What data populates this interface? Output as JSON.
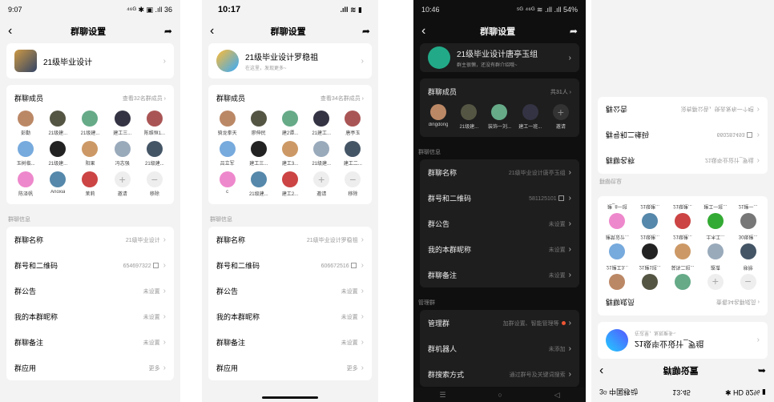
{
  "p1": {
    "time": "9:07",
    "status": "⁴⁶ᴳ ✱ ▣ .ıll 36",
    "title": "群聊设置",
    "group": "21级毕业设计",
    "members_label": "群聊成员",
    "members_more": "查看32名群成员",
    "members": [
      "彭勤",
      "21级建...",
      "21级建...",
      "建工三...",
      "陈维恒1...",
      "玉树临...",
      "21级建...",
      "阳果",
      "冯志强",
      "21级建...",
      "陈泽帆",
      "Anoxia",
      "茉莉",
      "邀请",
      "移除"
    ],
    "section": "群聊信息",
    "rows": [
      {
        "k": "群聊名称",
        "v": "21级毕业设计"
      },
      {
        "k": "群号和二维码",
        "v": "654697322"
      },
      {
        "k": "群公告",
        "v": "未设置"
      },
      {
        "k": "我的本群昵称",
        "v": "未设置"
      },
      {
        "k": "群聊备注",
        "v": "未设置"
      },
      {
        "k": "群应用",
        "v": "更多"
      }
    ]
  },
  "p2": {
    "time": "10:17",
    "title": "群聊设置",
    "group": "21级毕业设计罗稳祖",
    "group_sub": "在这里，发现更多~",
    "members_label": "群聊成员",
    "members_more": "查看34名群成员",
    "members": [
      "骑龙拳天",
      "廖伸民",
      "建2谭...",
      "21建工...",
      "唐亭玉",
      "吕立军",
      "建工三...",
      "建工3...",
      "21级建...",
      "建工二...",
      "c",
      "21级建...",
      "建工2...",
      "邀请",
      "移除"
    ],
    "section": "群聊信息",
    "rows": [
      {
        "k": "群聊名称",
        "v": "21级毕业设计罗稳祖"
      },
      {
        "k": "群号和二维码",
        "v": "606672516"
      },
      {
        "k": "群公告",
        "v": "未设置"
      },
      {
        "k": "我的本群昵称",
        "v": "未设置"
      },
      {
        "k": "群聊备注",
        "v": "未设置"
      },
      {
        "k": "群应用",
        "v": "更多"
      }
    ]
  },
  "p3": {
    "time": "10:46",
    "status": "⁵ᴳ ⁴⁶ᴳ ≋ .ıll .ıll 54%",
    "title": "群聊设置",
    "group": "21级毕业设计唐亭玉组",
    "group_sub": "群主很懒，还没有群介绍哦~",
    "members_label": "群聊成员",
    "members_more": "共31人",
    "members": [
      "dingdong",
      "21级建...",
      "装饰一刘...",
      "建工一班...",
      "邀请"
    ],
    "section": "群聊信息",
    "rows": [
      {
        "k": "群聊名称",
        "v": "21级毕业设计唐亭玉组"
      },
      {
        "k": "群号和二维码",
        "v": "581125101"
      },
      {
        "k": "群公告",
        "v": "未设置"
      },
      {
        "k": "我的本群昵称",
        "v": "未设置"
      },
      {
        "k": "群聊备注",
        "v": "未设置"
      }
    ],
    "section2": "管理群",
    "rows2": [
      {
        "k": "管理群",
        "v": "加群设置、智能管理等"
      },
      {
        "k": "群机器人",
        "v": "未添加"
      },
      {
        "k": "群搜索方式",
        "v": "通过群号及关键词搜索"
      }
    ]
  },
  "p4": {
    "time": "13:45",
    "carrier": "3ᴳ 中国移动",
    "title": "群聊设置",
    "group": "21级毕业设计_罗组",
    "group_sub": "在这里，发现更多~",
    "members_label": "群聊成员",
    "members_more": "查看34名群成员",
    "members": [
      "21建工3...",
      "21建1班...",
      "装饰二班...",
      "邀请",
      "移除",
      "建筑设计...",
      "21级建...",
      "21级建...",
      "土木工...",
      "30级建...",
      "建_8一班",
      "21级建...",
      "21级建...",
      "建工一班...",
      "21建一..."
    ],
    "section": "群聊信息",
    "rows": [
      {
        "k": "群聊名称",
        "v": "21级毕业设计_罗组"
      },
      {
        "k": "群号和二维码",
        "v": "660281493"
      },
      {
        "k": "群公告",
        "v": "没有群公告，快去发布一个吧"
      }
    ]
  },
  "colors": {
    "accent": "#e53935",
    "dark_bg": "#0f0f0f",
    "light_bg": "#f3f3f3"
  }
}
